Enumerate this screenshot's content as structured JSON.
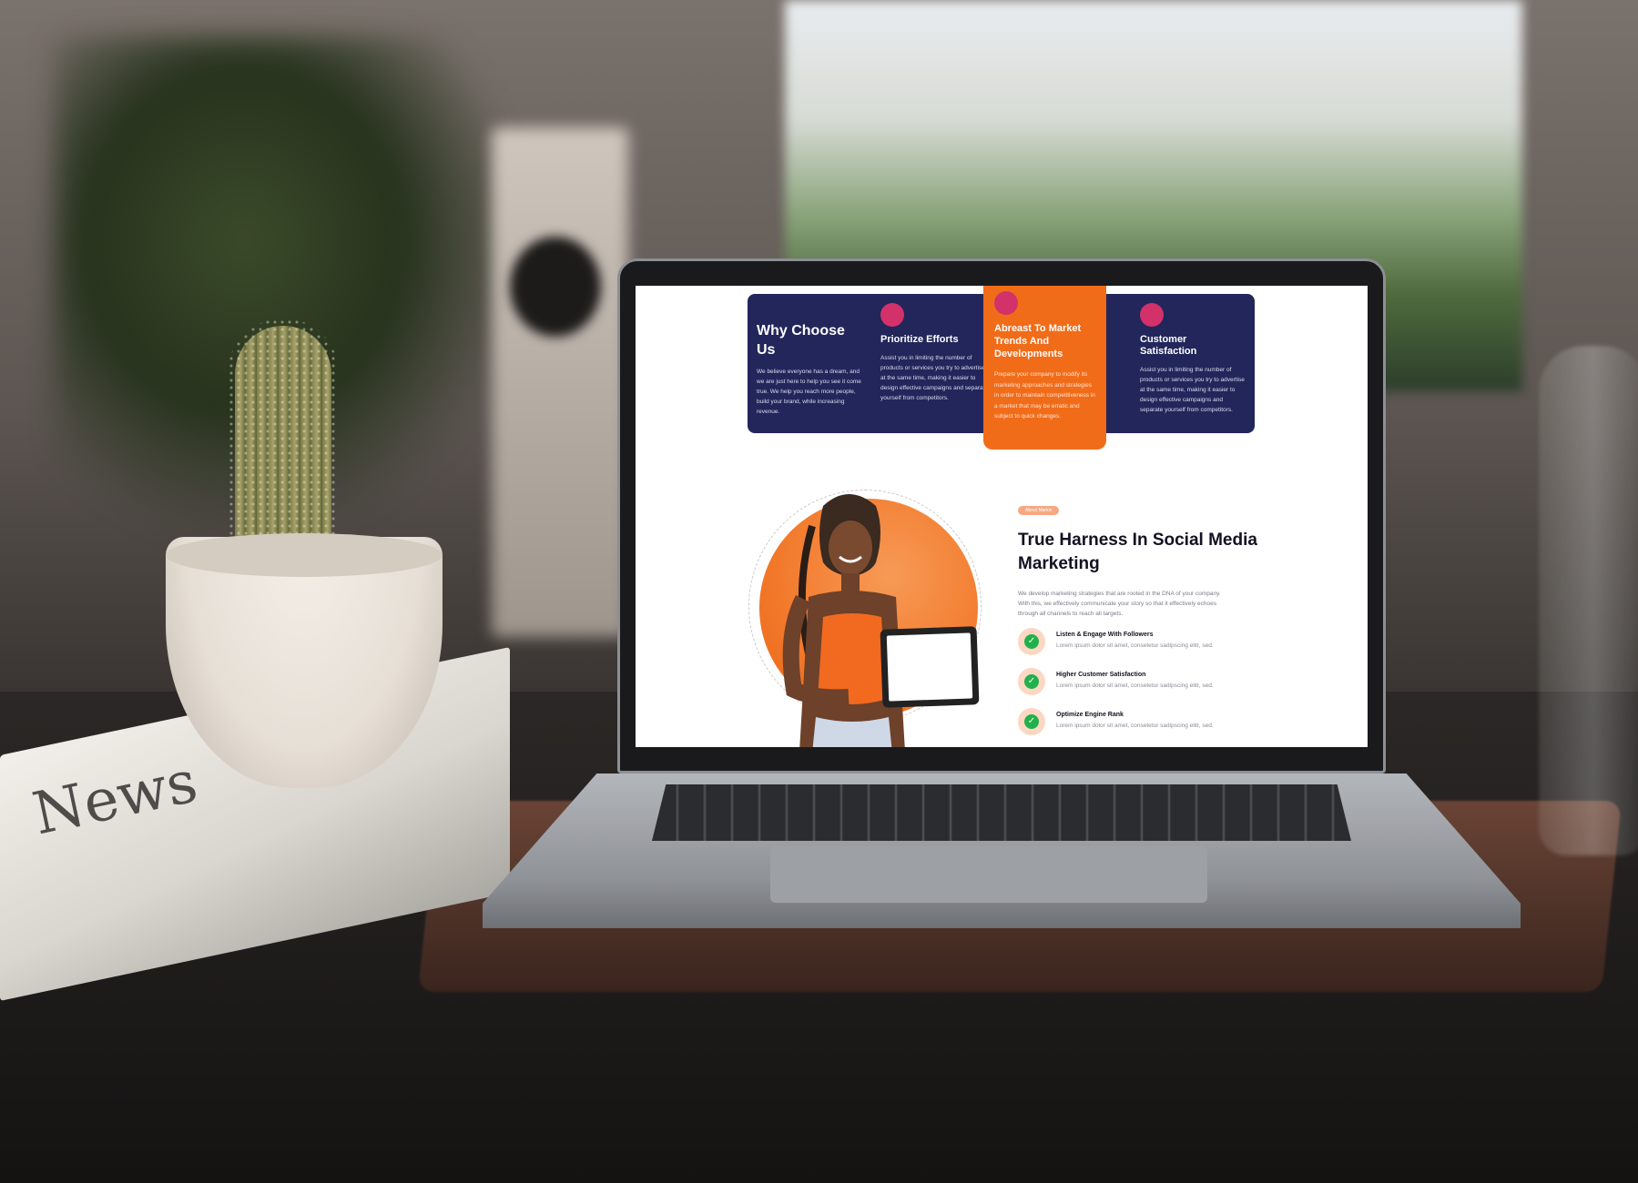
{
  "features": {
    "why": {
      "title": "Why Choose Us",
      "text": "We believe everyone has a dream, and we are just here to help you see it come true. We help you reach more people, build your brand, while increasing revenue."
    },
    "cards": [
      {
        "title": "Prioritize Efforts",
        "text": "Assist you in limiting the number of products or services you try to advertise at the same time, making it easier to design effective campaigns and separate yourself from competitors."
      },
      {
        "title": "Abreast To Market Trends And Developments",
        "text": "Prepare your company to modify its marketing approaches and strategies in order to maintain competitiveness in a market that may be erratic and subject to quick changes."
      },
      {
        "title": "Customer Satisfaction",
        "text": "Assist you in limiting the number of products or services you try to advertise at the same time, making it easier to design effective campaigns and separate yourself from competitors."
      }
    ]
  },
  "about": {
    "badge": "About Markin",
    "title": "True Harness In Social Media Marketing",
    "description": "We develop marketing strategies that are rooted in the DNA of your company. With this, we effectively communicate your story so that it effectively echoes through all channels to reach all targets.",
    "items": [
      {
        "title": "Listen & Engage With Followers",
        "text": "Lorem ipsum dolor sit amet, consetetur sadipscing elitr, sed."
      },
      {
        "title": "Higher Customer Satisfaction",
        "text": "Lorem ipsum dolor sit amet, consetetur sadipscing elitr, sed."
      },
      {
        "title": "Optimize Engine Rank",
        "text": "Lorem ipsum dolor sit amet, consetetur sadipscing elitr, sed."
      }
    ]
  },
  "scene": {
    "newspaper_text": "News"
  },
  "colors": {
    "navy": "#22265a",
    "orange": "#f16c19",
    "pink_dot": "#d2316a",
    "check_green": "#21b14b"
  }
}
